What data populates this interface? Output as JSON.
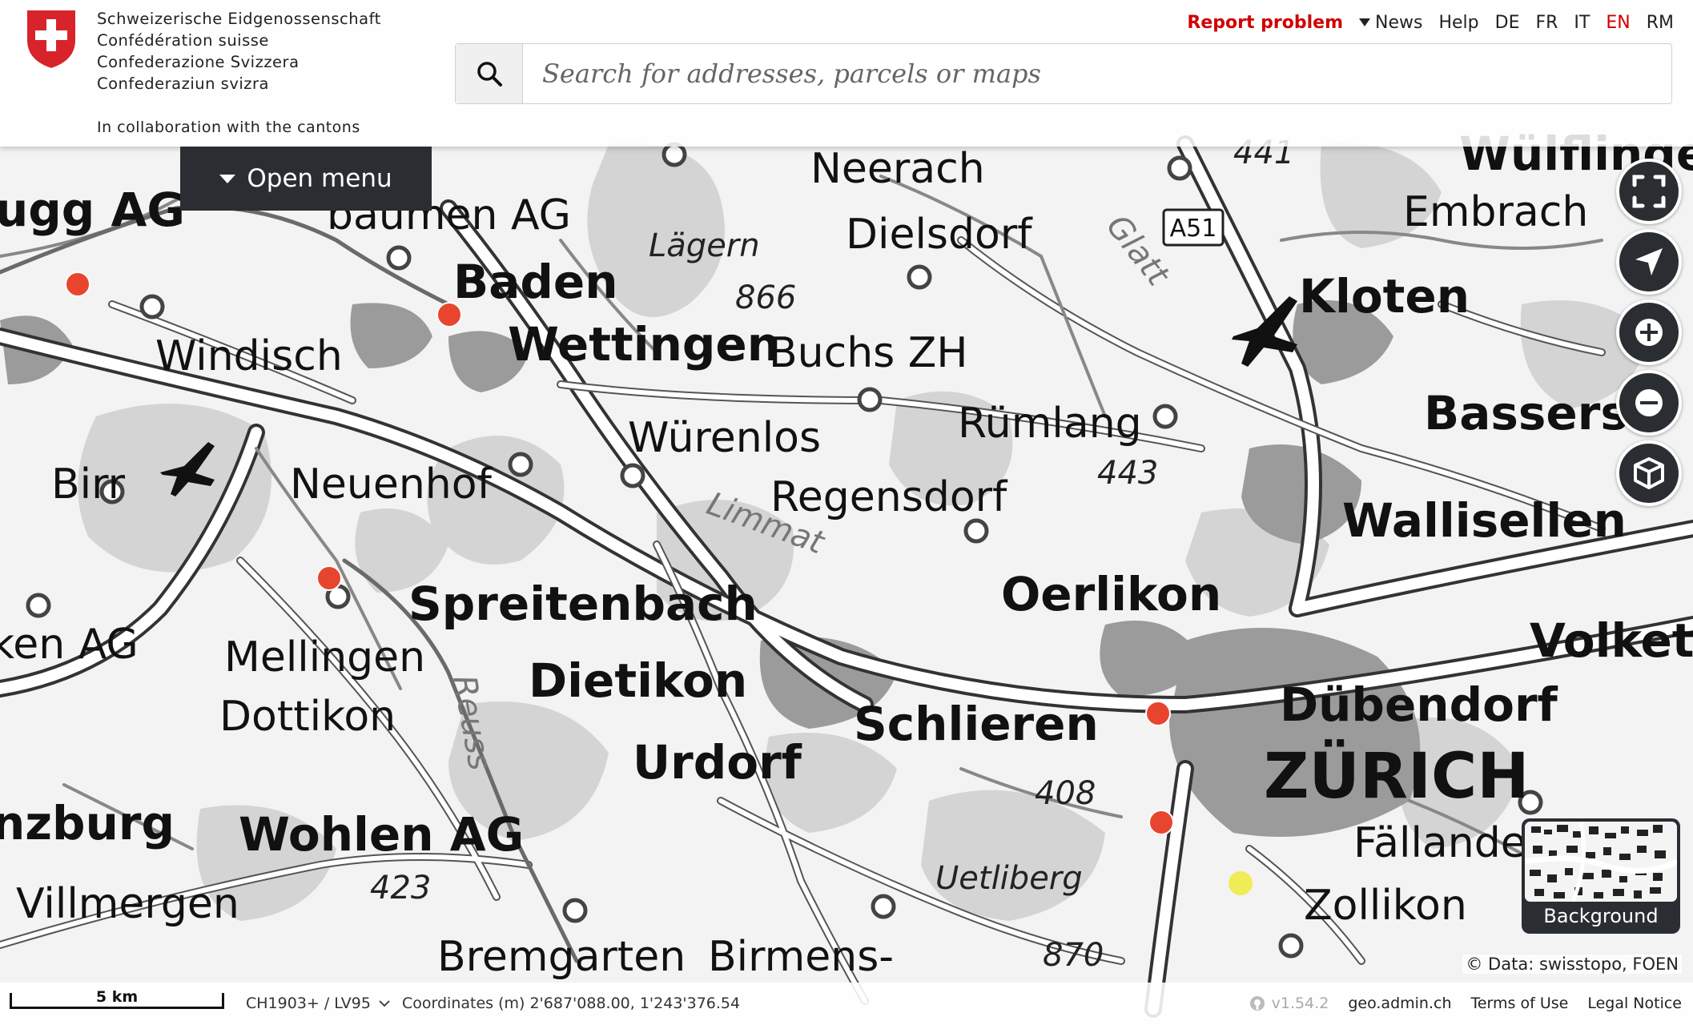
{
  "header": {
    "confederation_lines": [
      "Schweizerische Eidgenossenschaft",
      "Confédération suisse",
      "Confederazione Svizzera",
      "Confederaziun svizra"
    ],
    "collaboration": "In collaboration with the cantons",
    "report_problem": "Report problem",
    "news": "News",
    "help": "Help",
    "languages": [
      "DE",
      "FR",
      "IT",
      "EN",
      "RM"
    ],
    "active_language": "EN",
    "search_placeholder": "Search for addresses, parcels or maps"
  },
  "menu": {
    "open_menu_label": "Open menu"
  },
  "tools": {
    "fullscreen": "fullscreen-icon",
    "geolocation": "location-arrow-icon",
    "zoom_in": "plus-icon",
    "zoom_out": "minus-icon",
    "three_d": "cube-icon"
  },
  "background_selector": {
    "label": "Background"
  },
  "attribution": {
    "prefix": "© Data:",
    "sources": "swisstopo, FOEN"
  },
  "footer": {
    "scale_label": "5 km",
    "crs": "CH1903+ / LV95",
    "coordinates": "Coordinates (m) 2'687'088.00, 1'243'376.54",
    "version": "v1.54.2",
    "site": "geo.admin.ch",
    "terms": "Terms of Use",
    "legal": "Legal Notice"
  },
  "map": {
    "places": {
      "neerach": "Neerach",
      "dielsdorf": "Dielsdorf",
      "lagern": "Lägern",
      "lagern_height": "866",
      "baden": "Baden",
      "brugg_partial": "ugg AG",
      "baumen_partial": "baumen AG",
      "wettingen": "Wettingen",
      "buchs": "Buchs ZH",
      "windisch": "Windisch",
      "wurenlos": "Würenlos",
      "rumlang": "Rümlang",
      "kloten": "Kloten",
      "embrach": "Embrach",
      "wulflingen_partial": "Wülflinge",
      "bassersdorf_partial": "Bassersd",
      "birr": "Birr",
      "neuenhof": "Neuenhof",
      "regensdorf": "Regensdorf",
      "height_443": "443",
      "height_441": "441",
      "wallisellen": "Wallisellen",
      "limmat": "Limmat",
      "oerlikon": "Oerlikon",
      "spreitenbach": "Spreitenbach",
      "volketswil_partial": "Volkets",
      "ken_ag_partial": "ken AG",
      "mellingen": "Mellingen",
      "dietikon": "Dietikon",
      "dubendorf": "Dübendorf",
      "dottikon": "Dottikon",
      "schlieren": "Schlieren",
      "zurich": "ZÜRICH",
      "reuss": "Reuss",
      "urdorf": "Urdorf",
      "height_408": "408",
      "fallanden_partial": "Fällande",
      "lenzburg_partial": "nzburg",
      "wohlen": "Wohlen AG",
      "uetliberg": "Uetliberg",
      "zollikon": "Zollikon",
      "villmergen": "Villmergen",
      "height_423": "423",
      "bremgarten": "Bremgarten",
      "birmensdorf_partial": "Birmens-",
      "height_870": "870",
      "glatt": "Glatt",
      "motorway_a51": "A51"
    }
  }
}
